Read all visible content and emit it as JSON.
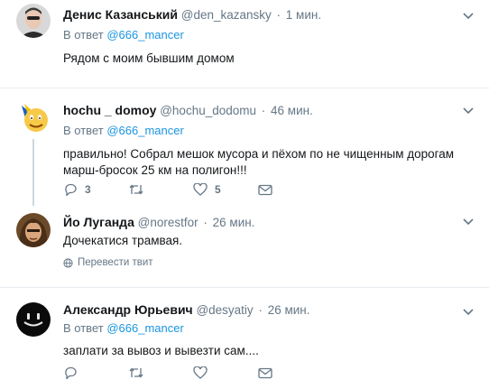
{
  "tweets": [
    {
      "name": "Денис Казанський",
      "handle": "@den_kazansky",
      "time": "1 мин.",
      "reply_prefix": "В ответ",
      "reply_to": "@666_mancer",
      "text": "Рядом с моим бывшим домом"
    },
    {
      "name": "hochu _ domoy",
      "handle": "@hochu_dodomu",
      "time": "46 мин.",
      "reply_prefix": "В ответ",
      "reply_to": "@666_mancer",
      "text": "правильно!  Собрал  мешок мусора и пёхом по не чищенным дорогам марш-бросок 25 км на полигон!!!",
      "reply_count": "3",
      "like_count": "5"
    },
    {
      "name": "Йо Луганда",
      "handle": "@norestfor",
      "time": "26 мин.",
      "text": "Дочекатися трамвая.",
      "translate": "Перевести твит"
    },
    {
      "name": "Александр Юрьевич",
      "handle": "@desyatiy",
      "time": "26 мин.",
      "reply_prefix": "В ответ",
      "reply_to": "@666_mancer",
      "text": "заплати за вывоз и вывезти сам...."
    }
  ],
  "colors": {
    "link": "#1b95e0",
    "secondary": "#657786",
    "divider": "#e6ecf0",
    "thread_line": "#ccd6dd"
  },
  "icons": {
    "reply": "reply-icon",
    "retweet": "retweet-icon",
    "like": "heart-icon",
    "dm": "envelope-icon",
    "caret": "chevron-down-icon",
    "globe": "globe-icon"
  }
}
